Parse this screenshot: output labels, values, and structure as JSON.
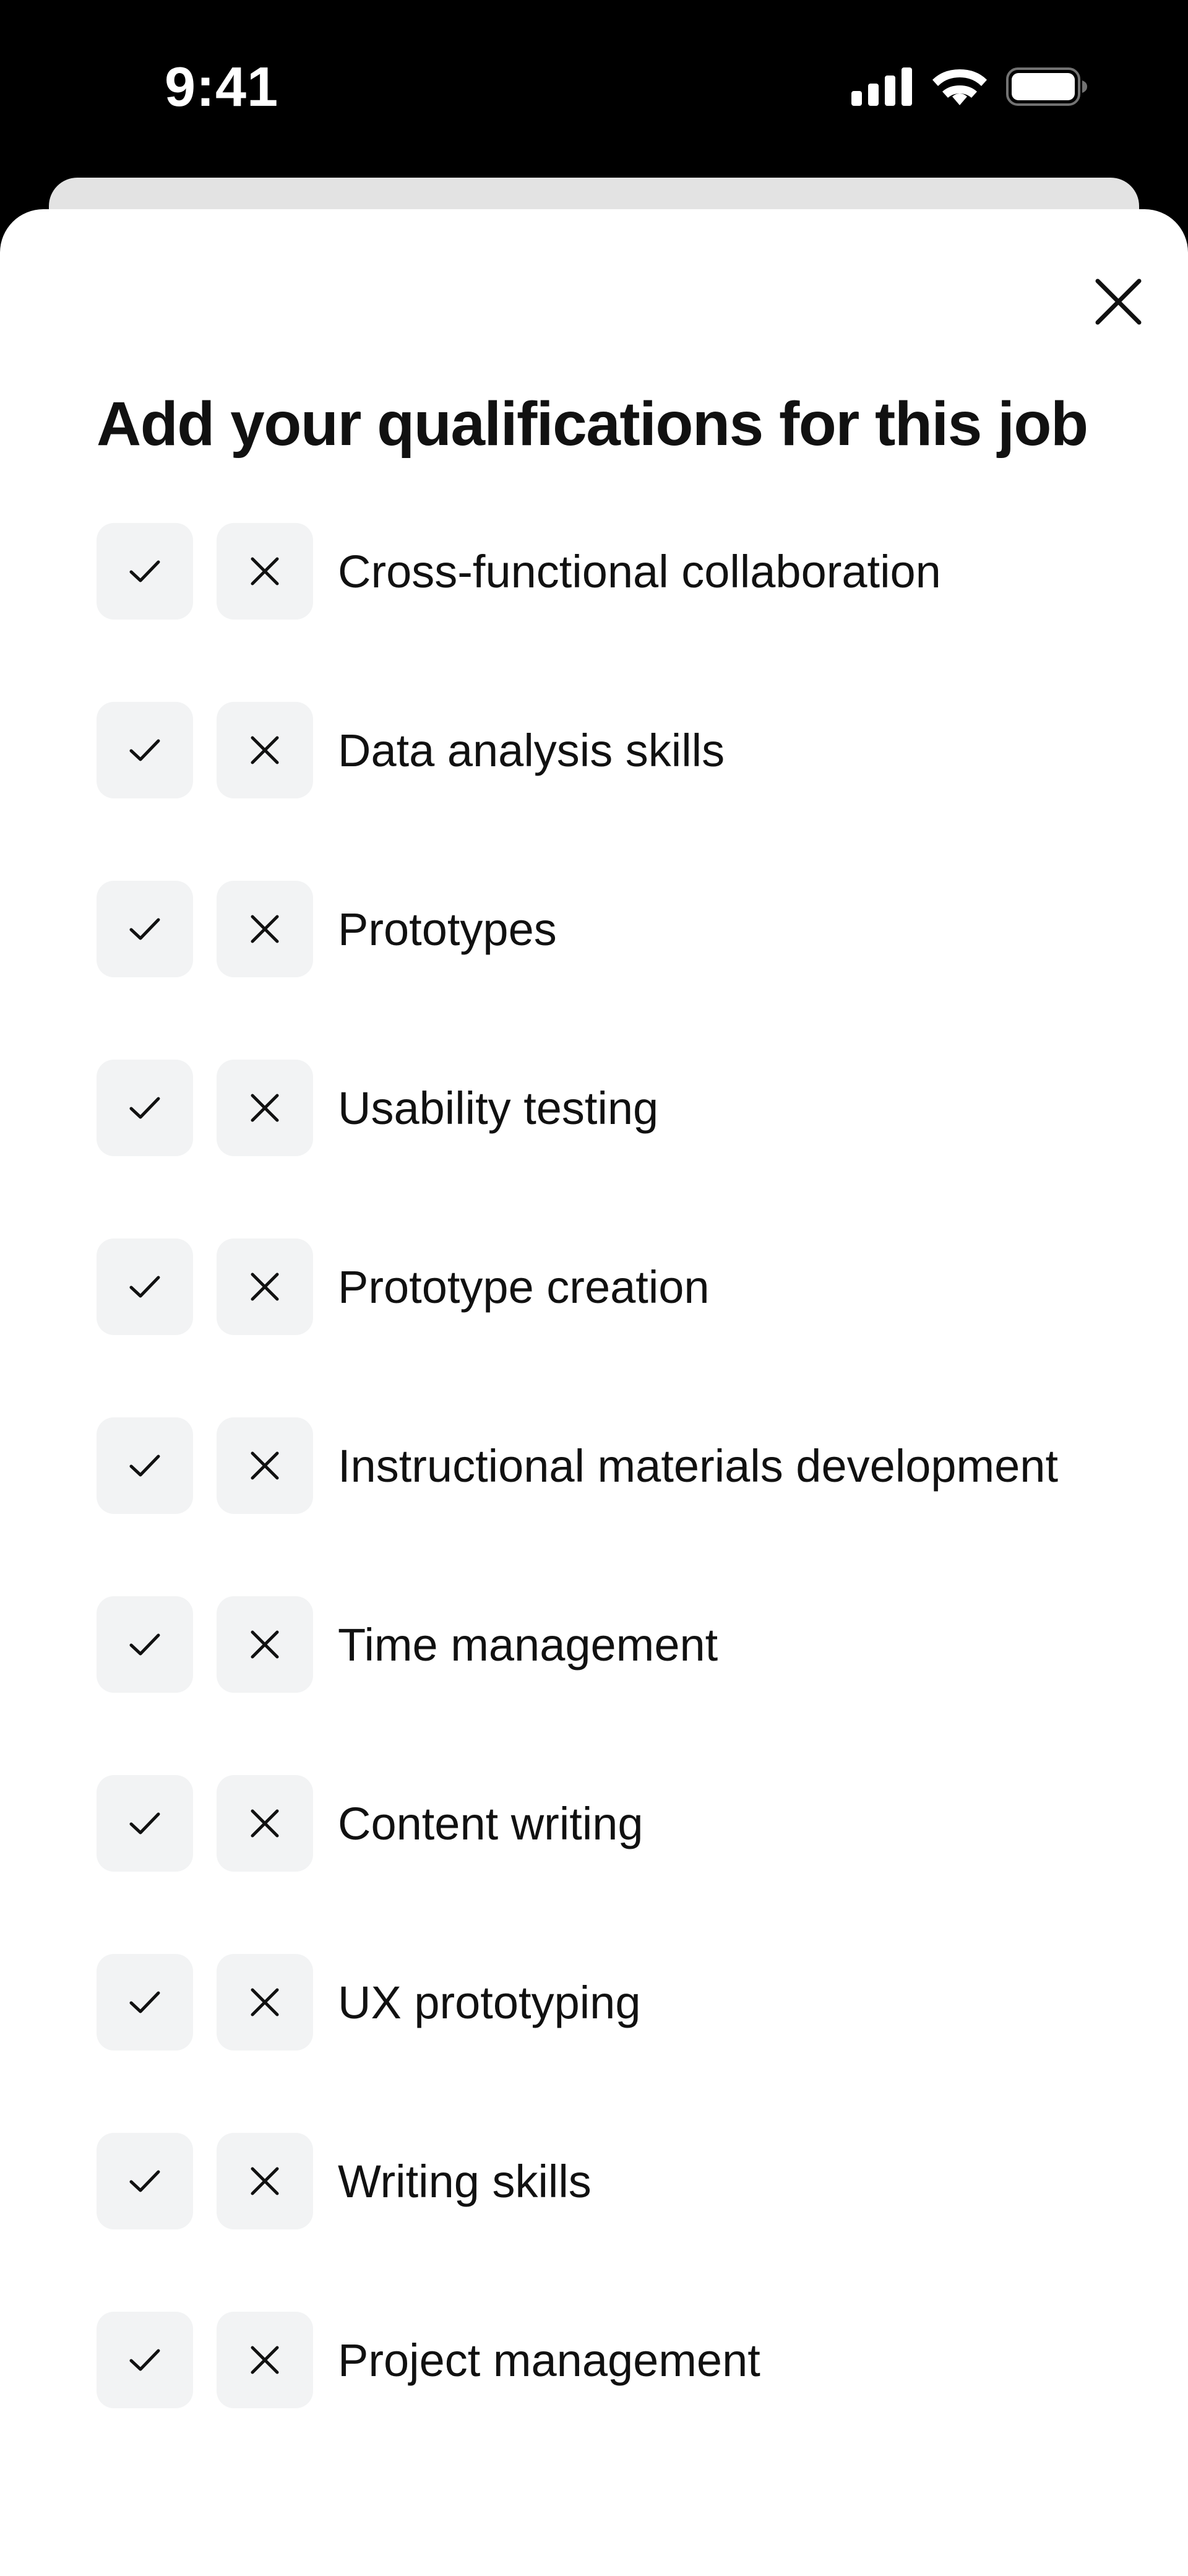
{
  "status_bar": {
    "time": "9:41",
    "icons": [
      "cellular-signal-icon",
      "wifi-icon",
      "battery-icon"
    ]
  },
  "sheet": {
    "title": "Add your qualifications for this job",
    "close_icon": "close-icon"
  },
  "qualifications": [
    {
      "label": "Cross-functional collaboration"
    },
    {
      "label": "Data analysis skills"
    },
    {
      "label": "Prototypes"
    },
    {
      "label": "Usability testing"
    },
    {
      "label": "Prototype creation"
    },
    {
      "label": "Instructional materials development"
    },
    {
      "label": "Time management"
    },
    {
      "label": "Content writing"
    },
    {
      "label": "UX prototyping"
    },
    {
      "label": "Writing skills"
    },
    {
      "label": "Project management"
    }
  ],
  "colors": {
    "background": "#000000",
    "sheet": "#ffffff",
    "back_card": "#e3e3e3",
    "button_bg": "#f2f3f4",
    "text": "#111111"
  }
}
